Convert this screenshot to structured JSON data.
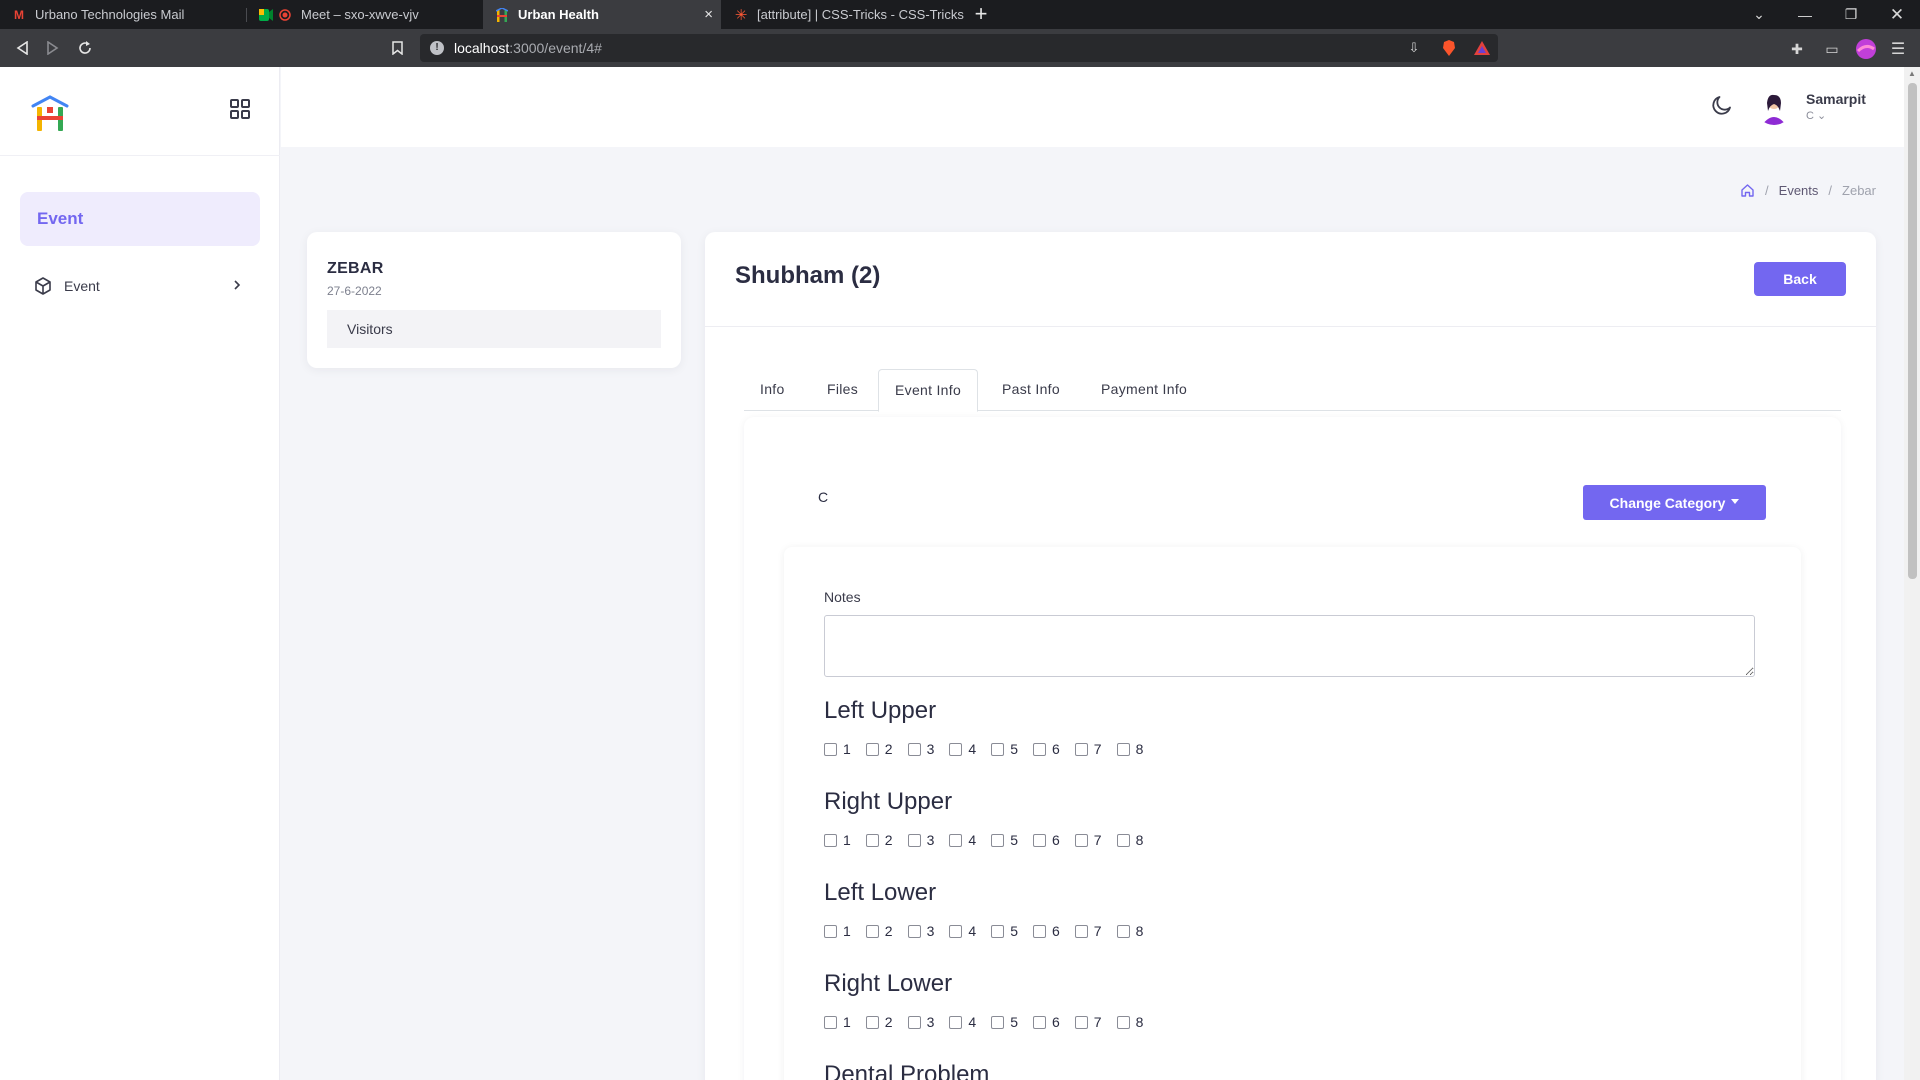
{
  "browser": {
    "tabs": [
      {
        "label": "Urbano Technologies Mail",
        "icon": "gmail-icon"
      },
      {
        "label": "Meet – sxo-xwve-vjv",
        "icon": "meet-icon"
      },
      {
        "label": "Urban Health",
        "icon": "urban-health-icon",
        "active": true
      },
      {
        "label": "[attribute] | CSS-Tricks - CSS-Tricks",
        "icon": "css-tricks-icon"
      }
    ],
    "url_host": "localhost",
    "url_path": ":3000/event/4#"
  },
  "sidebar": {
    "section_label": "Event",
    "items": [
      {
        "label": "Event",
        "icon": "cube-icon"
      }
    ]
  },
  "user": {
    "name": "Samarpit",
    "role": "C"
  },
  "breadcrumb": {
    "items": [
      "Events",
      "Zebar"
    ]
  },
  "event_card": {
    "title": "ZEBAR",
    "date": "27-6-2022",
    "link": "Visitors"
  },
  "main": {
    "title": "Shubham (2)",
    "back_label": "Back",
    "tabs": [
      "Info",
      "Files",
      "Event Info",
      "Past Info",
      "Payment Info"
    ],
    "active_tab": "Event Info",
    "category": "C",
    "change_category_label": "Change Category",
    "notes_label": "Notes",
    "notes_value": "",
    "quadrants": [
      {
        "title": "Left Upper",
        "teeth": [
          "1",
          "2",
          "3",
          "4",
          "5",
          "6",
          "7",
          "8"
        ]
      },
      {
        "title": "Right Upper",
        "teeth": [
          "1",
          "2",
          "3",
          "4",
          "5",
          "6",
          "7",
          "8"
        ]
      },
      {
        "title": "Left Lower",
        "teeth": [
          "1",
          "2",
          "3",
          "4",
          "5",
          "6",
          "7",
          "8"
        ]
      },
      {
        "title": "Right Lower",
        "teeth": [
          "1",
          "2",
          "3",
          "4",
          "5",
          "6",
          "7",
          "8"
        ]
      }
    ],
    "next_section": "Dental Problem"
  },
  "colors": {
    "accent": "#7367f0",
    "accent_light": "#efecfd"
  }
}
